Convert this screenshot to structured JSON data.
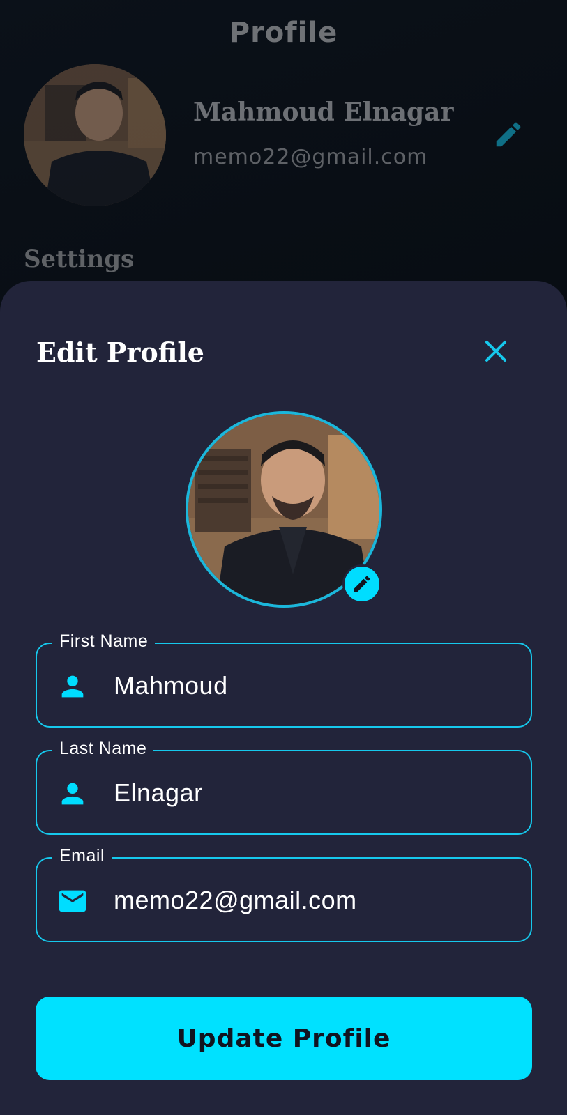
{
  "background_page": {
    "title": "Profile",
    "user_name": "Mahmoud Elnagar",
    "user_email": "memo22@gmail.com",
    "settings_heading": "Settings"
  },
  "sheet": {
    "title": "Edit Profile",
    "fields": [
      {
        "label": "First Name",
        "value": "Mahmoud",
        "icon": "person-icon"
      },
      {
        "label": "Last Name",
        "value": "Elnagar",
        "icon": "person-icon"
      },
      {
        "label": "Email",
        "value": "memo22@gmail.com",
        "icon": "mail-icon"
      }
    ],
    "submit_label": "Update Profile"
  },
  "colors": {
    "accent": "#00e1ff",
    "sheet_bg": "#22243a",
    "page_bg": "#060a0f",
    "muted_edit_icon": "#0f6f86"
  }
}
